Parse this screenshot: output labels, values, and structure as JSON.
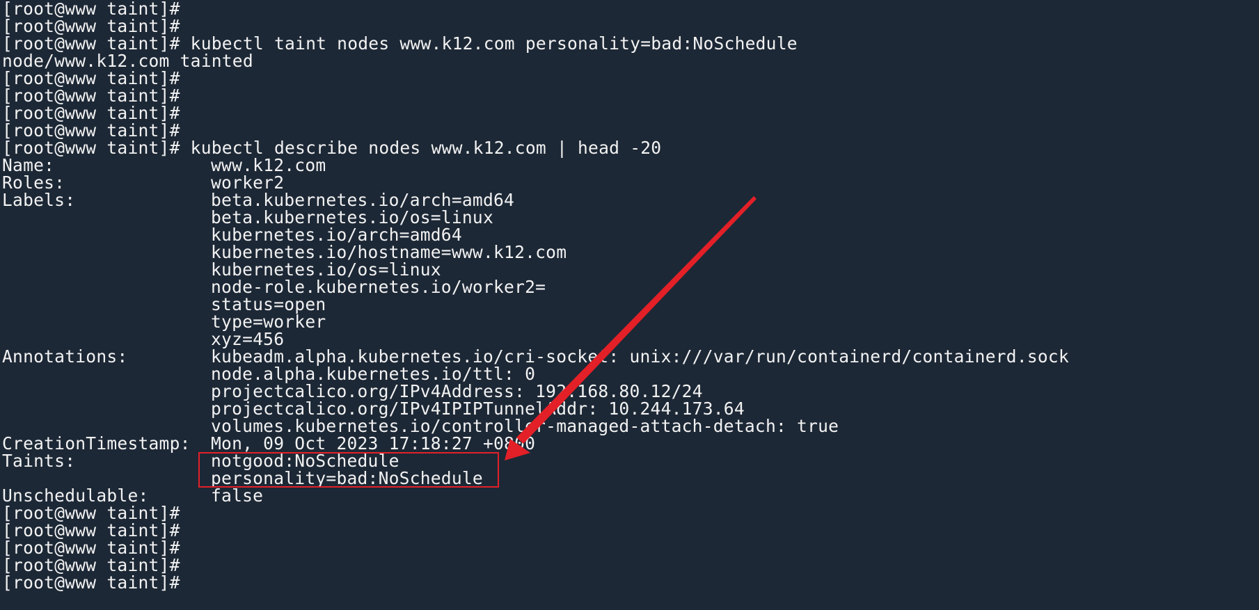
{
  "terminal": {
    "prompt": "[root@www taint]#",
    "lines": [
      {
        "type": "prompt",
        "command": ""
      },
      {
        "type": "prompt",
        "command": ""
      },
      {
        "type": "prompt",
        "command": "kubectl taint nodes www.k12.com personality=bad:NoSchedule"
      },
      {
        "type": "output",
        "text": "node/www.k12.com tainted"
      },
      {
        "type": "prompt",
        "command": ""
      },
      {
        "type": "prompt",
        "command": ""
      },
      {
        "type": "prompt",
        "command": ""
      },
      {
        "type": "prompt",
        "command": ""
      },
      {
        "type": "prompt",
        "command": "kubectl describe nodes www.k12.com | head -20"
      }
    ],
    "describe": [
      {
        "key": "Name:",
        "values": [
          "www.k12.com"
        ]
      },
      {
        "key": "Roles:",
        "values": [
          "worker2"
        ]
      },
      {
        "key": "Labels:",
        "values": [
          "beta.kubernetes.io/arch=amd64",
          "beta.kubernetes.io/os=linux",
          "kubernetes.io/arch=amd64",
          "kubernetes.io/hostname=www.k12.com",
          "kubernetes.io/os=linux",
          "node-role.kubernetes.io/worker2=",
          "status=open",
          "type=worker",
          "xyz=456"
        ]
      },
      {
        "key": "Annotations:",
        "values": [
          "kubeadm.alpha.kubernetes.io/cri-socket: unix:///var/run/containerd/containerd.sock",
          "node.alpha.kubernetes.io/ttl: 0",
          "projectcalico.org/IPv4Address: 192.168.80.12/24",
          "projectcalico.org/IPv4IPIPTunnelAddr: 10.244.173.64",
          "volumes.kubernetes.io/controller-managed-attach-detach: true"
        ]
      },
      {
        "key": "CreationTimestamp:",
        "values": [
          "Mon, 09 Oct 2023 17:18:27 +0800"
        ]
      },
      {
        "key": "Taints:",
        "values": [
          "notgood:NoSchedule",
          "personality=bad:NoSchedule"
        ]
      },
      {
        "key": "Unschedulable:",
        "values": [
          "false"
        ]
      }
    ],
    "trailing_prompts": 5
  },
  "annotation": {
    "highlight_color": "#e32027",
    "highlighted_field": "Taints",
    "arrow_icon": "red-arrow-icon"
  },
  "colors": {
    "background": "#1d2836",
    "foreground": "#f2f2f2"
  }
}
